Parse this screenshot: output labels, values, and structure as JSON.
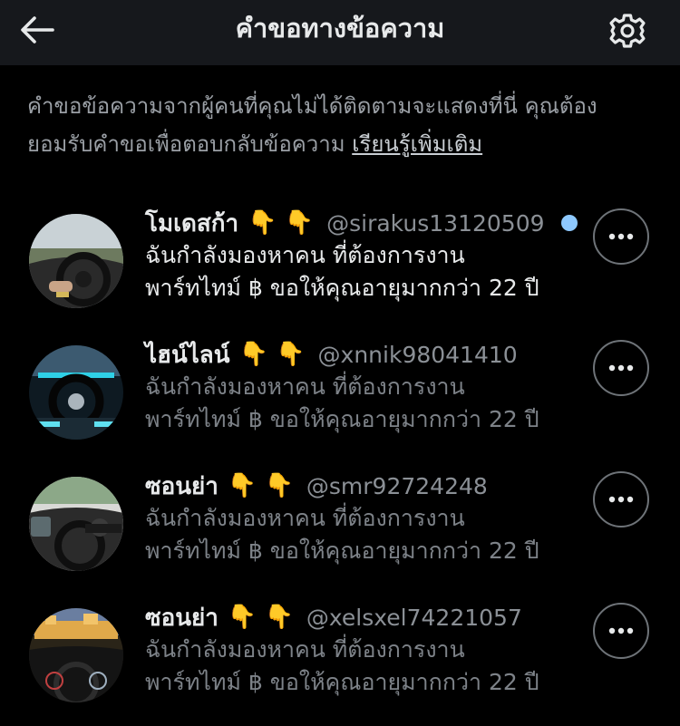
{
  "header": {
    "title": "คำขอทางข้อความ",
    "back_icon": "arrow-left-icon",
    "settings_icon": "gear-icon"
  },
  "info": {
    "text": "คำขอข้อความจากผู้คนที่คุณไม่ได้ติดตามจะแสดงที่นี่ คุณต้องยอมรับคำขอเพื่อตอบกลับข้อความ",
    "learn_more": "เรียนรู้เพิ่มเติม"
  },
  "requests": [
    {
      "name": "โมเดสก้า",
      "emoji": "👇 👇",
      "handle": "@sirakus13120509",
      "unread": true,
      "message_line1": "ฉันกำลังมองหาคน ที่ต้องการงาน",
      "message_line2": "พาร์ทไทม์ ฿ ขอให้คุณอายุมากกว่า 22 ปี"
    },
    {
      "name": "ไฮน์ไลน์",
      "emoji": "👇 👇",
      "handle": "@xnnik98041410",
      "unread": false,
      "message_line1": "ฉันกำลังมองหาคน ที่ต้องการงาน",
      "message_line2": "พาร์ทไทม์ ฿ ขอให้คุณอายุมากกว่า 22 ปี"
    },
    {
      "name": "ซอนย่า",
      "emoji": "👇 👇",
      "handle": "@smr92724248",
      "unread": false,
      "message_line1": "ฉันกำลังมองหาคน ที่ต้องการงาน",
      "message_line2": "พาร์ทไทม์ ฿ ขอให้คุณอายุมากกว่า 22 ปี"
    },
    {
      "name": "ซอนย่า",
      "emoji": "👇 👇",
      "handle": "@xelsxel74221057",
      "unread": false,
      "message_line1": "ฉันกำลังมองหาคน ที่ต้องการงาน",
      "message_line2": "พาร์ทไทม์ ฿ ขอให้คุณอายุมากกว่า 22 ปี"
    }
  ],
  "colors": {
    "background": "#000000",
    "header_bg": "#16181c",
    "text_primary": "#e7e9ea",
    "text_secondary": "#7d8288",
    "unread_dot": "#8ec9ff"
  },
  "icons": {
    "more": "more-horizontal-icon",
    "avatar": "car-interior-photo"
  }
}
